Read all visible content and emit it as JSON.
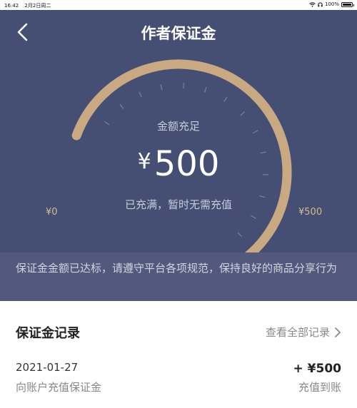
{
  "status_bar": {
    "time": "16:42",
    "date": "2月2日周二",
    "battery": "100%",
    "icons": [
      "wifi-icon",
      "headphones-icon",
      "battery-icon"
    ]
  },
  "header": {
    "title": "作者保证金",
    "back_icon": "chevron-left-icon"
  },
  "gauge": {
    "status": "金额充足",
    "currency": "¥",
    "amount": "500",
    "note": "已充满，暂时无需充值",
    "min_label": "¥0",
    "max_label": "¥500",
    "fill_fraction": 1.0,
    "arc_color": "#c9a982",
    "background_color": "#454f74"
  },
  "notice": {
    "text": "保证金金额已达标，请遵守平台各项规范，保持良好的商品分享行为"
  },
  "records": {
    "title": "保证金记录",
    "view_all": "查看全部记录",
    "view_all_icon": "chevron-right-icon",
    "items": [
      {
        "date": "2021-01-27",
        "description": "向账户充值保证金",
        "amount": "+ ¥500",
        "status": "充值到账"
      }
    ]
  }
}
